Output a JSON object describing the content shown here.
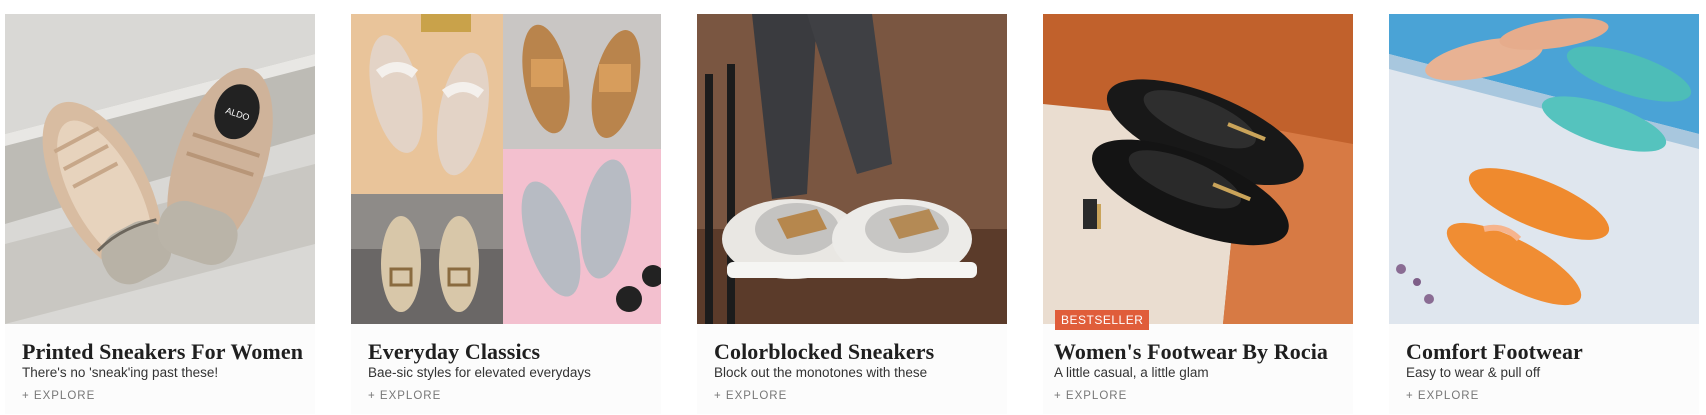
{
  "cards": [
    {
      "title": "Printed Sneakers For Women",
      "subtitle": "There's no 'sneak'ing past these!",
      "explore": "+ EXPLORE",
      "image_icon": "printed-sneakers-image"
    },
    {
      "title": "Everyday Classics",
      "subtitle": "Bae-sic styles for elevated everydays",
      "explore": "+ EXPLORE",
      "image_icon": "everyday-classics-image"
    },
    {
      "title": "Colorblocked Sneakers",
      "subtitle": "Block out the monotones with these",
      "explore": "+ EXPLORE",
      "image_icon": "colorblocked-sneakers-image"
    },
    {
      "title": "Women's Footwear By Rocia",
      "subtitle": "A little casual, a little glam",
      "explore": "+ EXPLORE",
      "badge": "BESTSELLER",
      "image_icon": "rocia-footwear-image"
    },
    {
      "title": "Comfort Footwear",
      "subtitle": "Easy to wear & pull off",
      "explore": "+ EXPLORE",
      "image_icon": "comfort-footwear-image"
    }
  ],
  "colors": {
    "badge": "#e05d3a",
    "caption_bg": "#fcfcfc",
    "explore_text": "#777777"
  }
}
